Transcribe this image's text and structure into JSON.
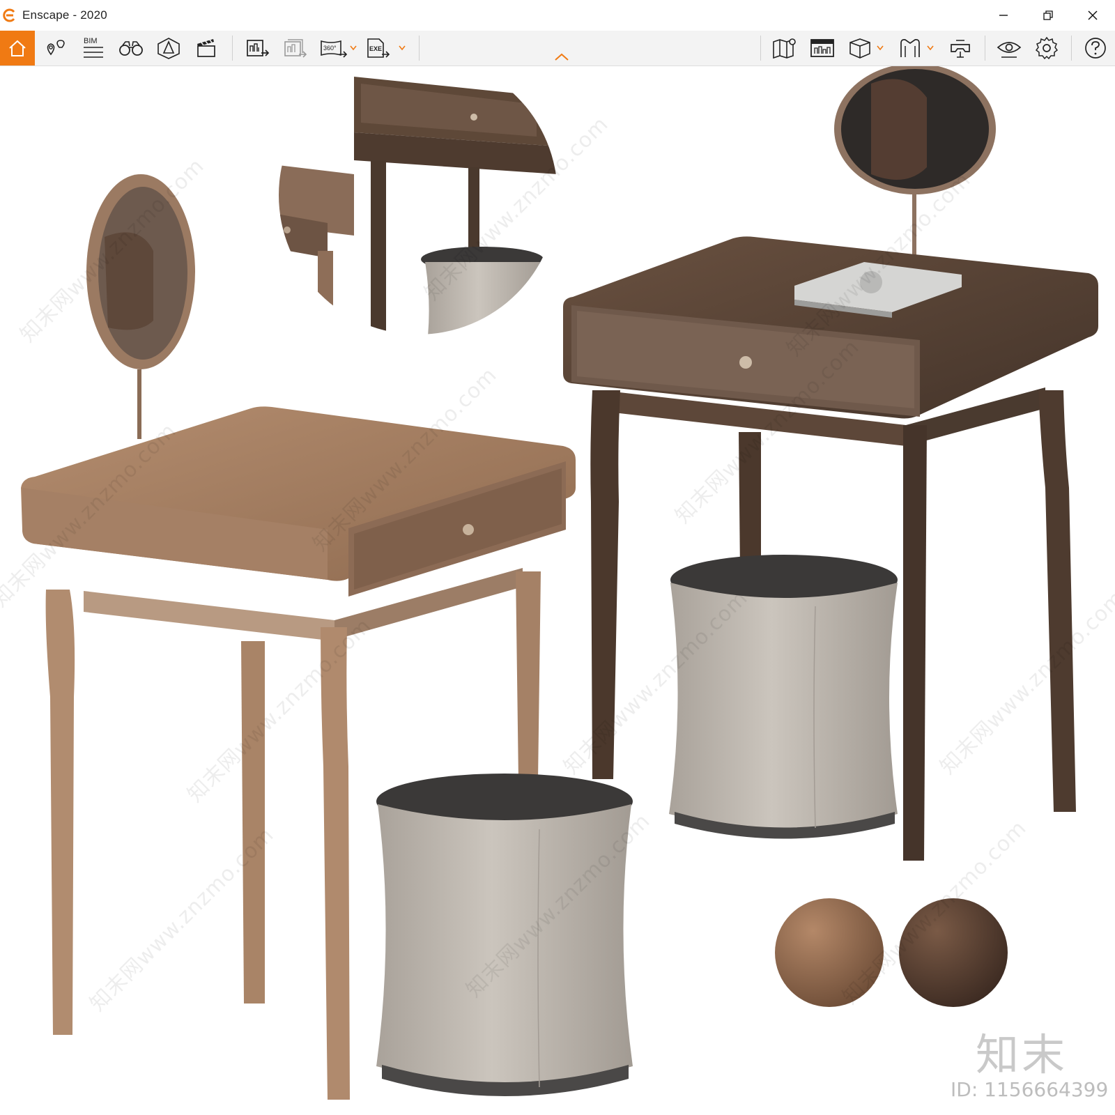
{
  "window": {
    "title": "Enscape - 2020",
    "accent_color": "#f07a13"
  },
  "toolbar": {
    "bim_label": "BIM",
    "pano_label": "360°",
    "exe_label": "EXE",
    "left_tools": [
      {
        "name": "home-icon"
      },
      {
        "name": "views-icon"
      },
      {
        "name": "bim-icon"
      },
      {
        "name": "binoculars-icon"
      },
      {
        "name": "asset-library-icon"
      },
      {
        "name": "video-editor-icon"
      },
      {
        "name": "render-screenshot-icon"
      },
      {
        "name": "batch-render-icon"
      },
      {
        "name": "panorama-360-icon"
      },
      {
        "name": "export-exe-icon"
      }
    ],
    "right_tools": [
      {
        "name": "minimap-icon"
      },
      {
        "name": "visual-settings-icon"
      },
      {
        "name": "cube-view-icon"
      },
      {
        "name": "vr-headset-icon"
      },
      {
        "name": "collaboration-icon"
      },
      {
        "name": "preview-eye-icon"
      },
      {
        "name": "settings-gear-icon"
      },
      {
        "name": "help-icon"
      }
    ]
  },
  "scene": {
    "wood_light": "#a98467",
    "wood_dark": "#5a4536",
    "fabric": "#bdb6ae",
    "cushion_top": "#3b3938",
    "watermark_text": "知末网www.znzmo.com",
    "brand_mark": "知末",
    "brand_id": "ID: 1156664399"
  }
}
